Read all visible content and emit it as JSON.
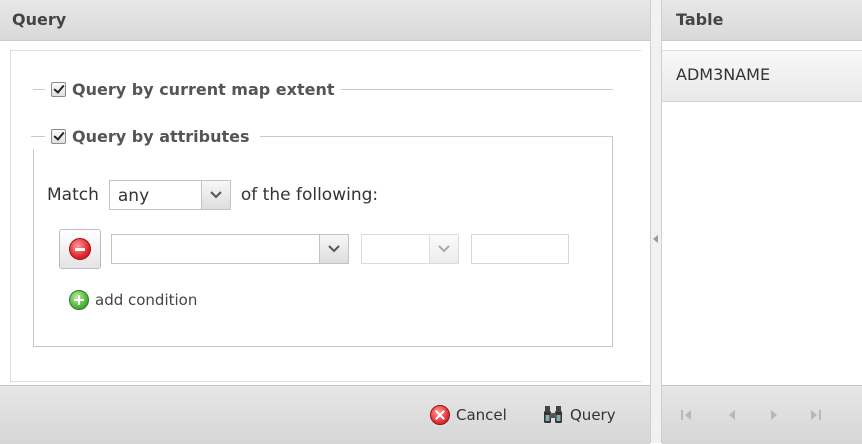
{
  "query_panel": {
    "title": "Query",
    "extent_checkbox": {
      "label": "Query by current map extent",
      "checked": true
    },
    "attributes_checkbox": {
      "label": "Query by attributes",
      "checked": true
    },
    "match_row": {
      "prefix": "Match",
      "selected": "any",
      "suffix": "of the following:"
    },
    "condition": {
      "field_value": "",
      "operator_value": "",
      "value_text": ""
    },
    "add_condition_label": "add condition",
    "footer": {
      "cancel_label": "Cancel",
      "query_label": "Query"
    }
  },
  "table_panel": {
    "title": "Table",
    "column_header": "ADM3NAME"
  }
}
